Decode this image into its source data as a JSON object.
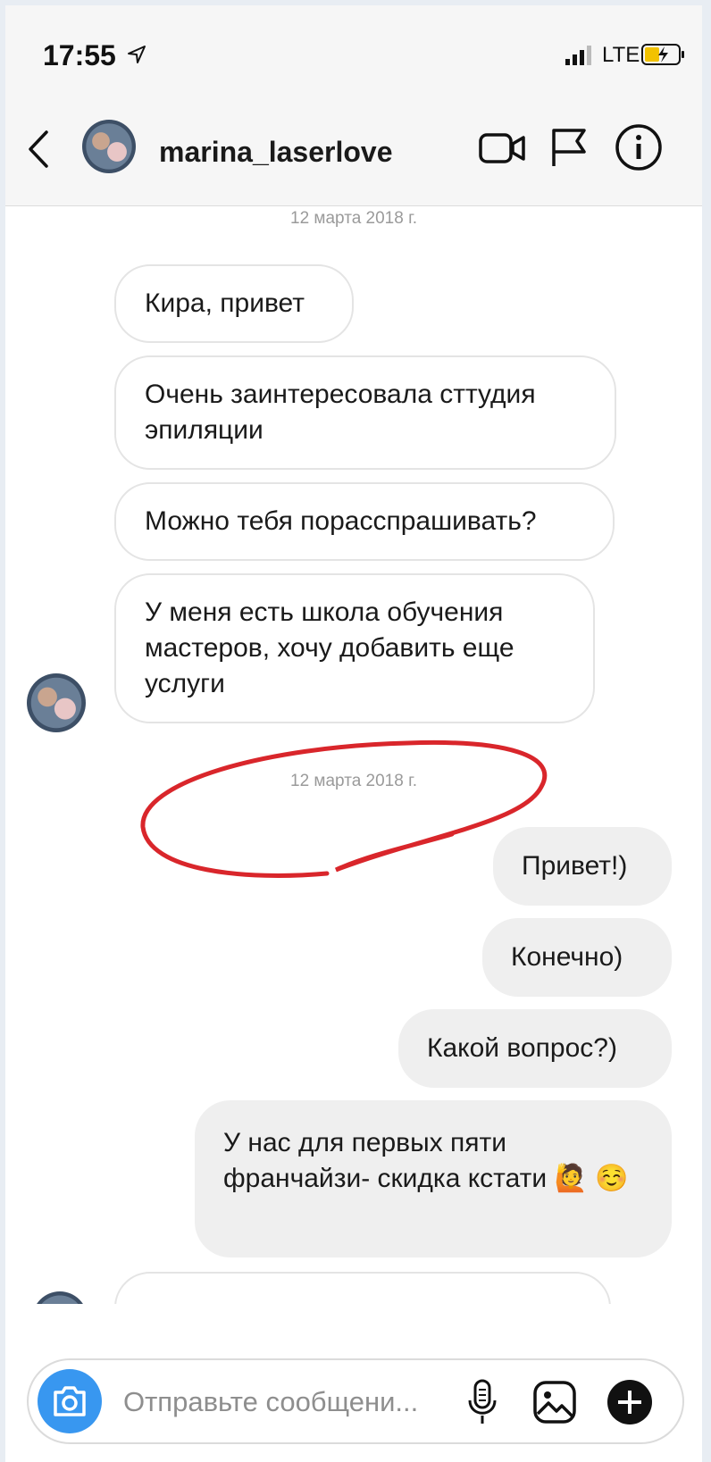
{
  "status_bar": {
    "time": "17:55",
    "network": "LTE"
  },
  "header": {
    "username": "marina_laserlove"
  },
  "messages": [
    {
      "kind": "date",
      "text": "12 марта 2018 г."
    },
    {
      "kind": "in",
      "text": "Кира, привет"
    },
    {
      "kind": "in",
      "text": "Очень заинтересовала сттудия эпиляции"
    },
    {
      "kind": "in",
      "text": "Можно тебя порасспрашивать?"
    },
    {
      "kind": "in",
      "text": "У меня есть школа обучения мастеров, хочу добавить еще услуги"
    },
    {
      "kind": "date",
      "text": "12 марта 2018 г."
    },
    {
      "kind": "out",
      "text": "Привет!)"
    },
    {
      "kind": "out",
      "text": "Конечно)"
    },
    {
      "kind": "out",
      "text": "Какой вопрос?)"
    },
    {
      "kind": "out",
      "text": "У нас для первых пяти франчайзи- скидка кстати 🙋 ☺️"
    }
  ],
  "composer": {
    "placeholder": "Отправьте сообщени..."
  },
  "colors": {
    "accent": "#3897f0",
    "annotation": "#d9262b",
    "incoming_bg": "#ffffff",
    "outgoing_bg": "#efefef"
  },
  "icons": [
    "back-icon",
    "video-call-icon",
    "flag-icon",
    "info-icon",
    "camera-icon",
    "microphone-icon",
    "gallery-icon",
    "plus-icon"
  ]
}
